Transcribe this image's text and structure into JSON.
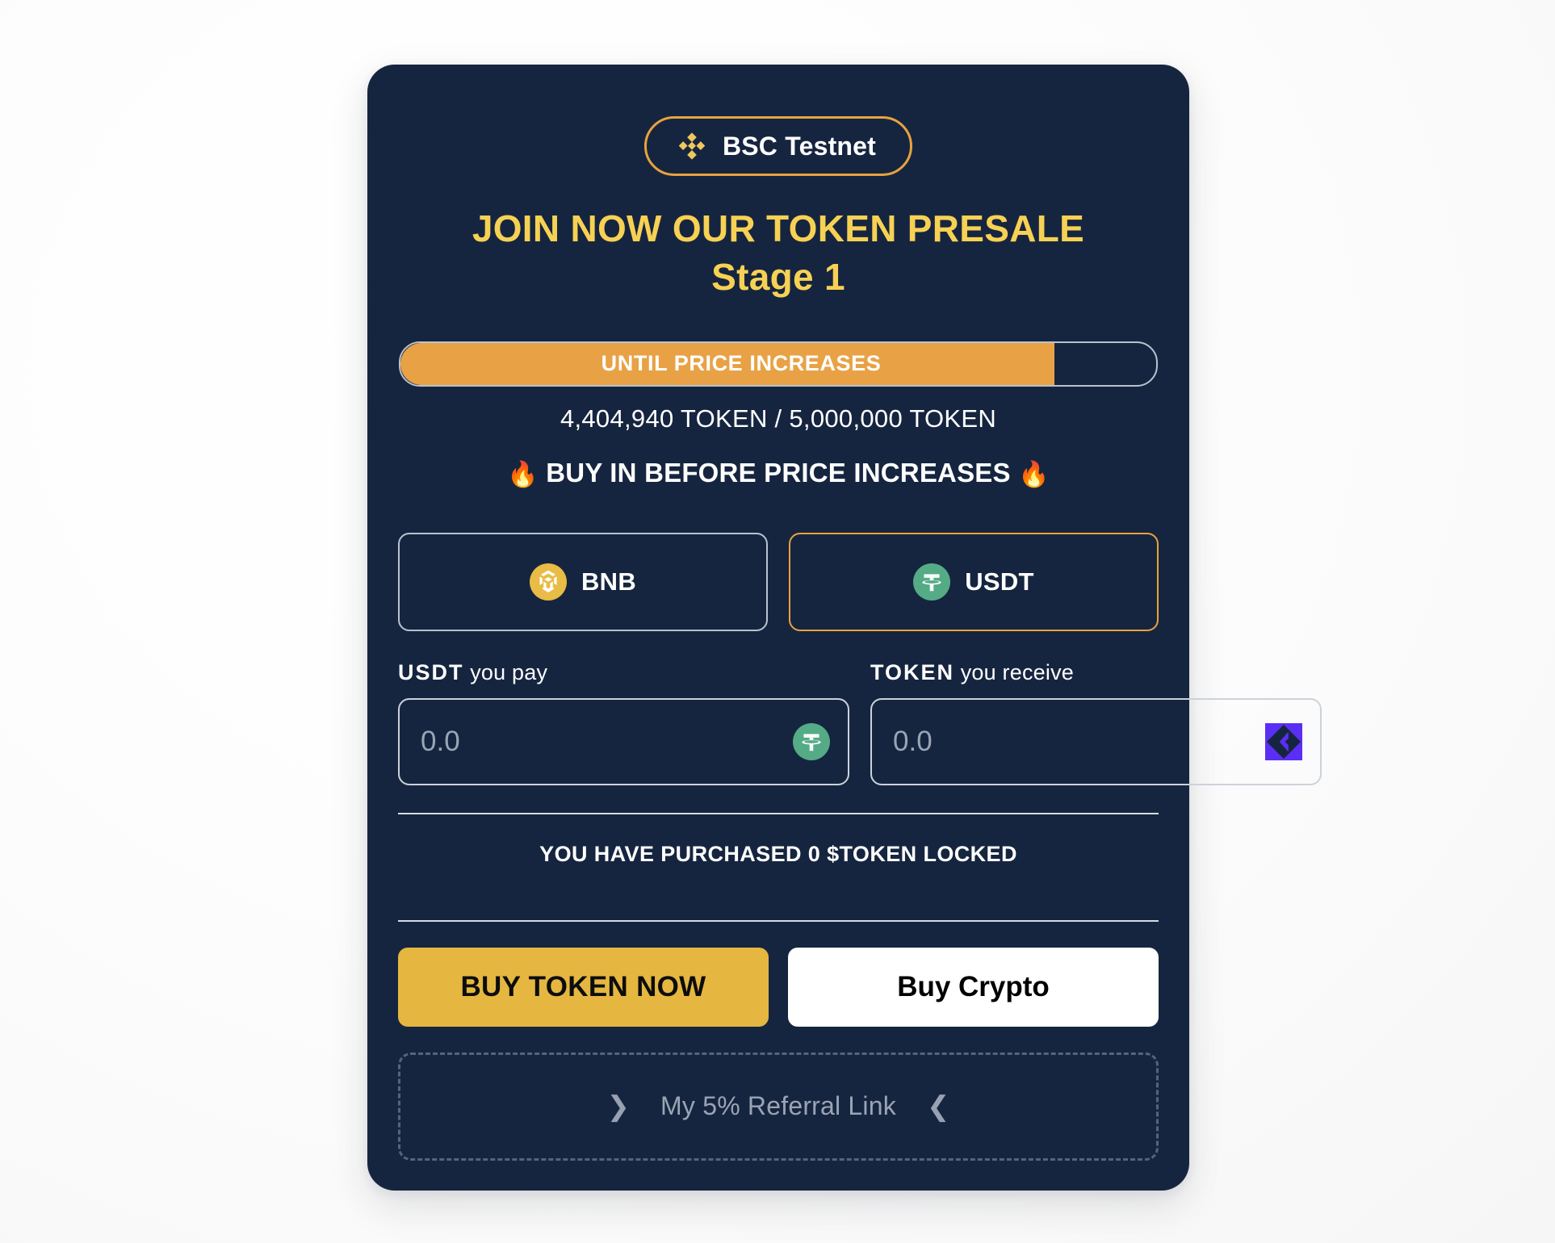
{
  "network": {
    "label": "BSC Testnet",
    "icon": "bnb-diamond-icon",
    "border_color": "#e8a33d"
  },
  "headline": {
    "line1": "JOIN NOW OUR TOKEN PRESALE",
    "line2": "Stage 1",
    "color": "#f7d154"
  },
  "progress": {
    "label": "UNTIL PRICE INCREASES",
    "percent": 86.5,
    "fill_color": "#e8a245",
    "sold": "4,404,940 TOKEN",
    "total": "5,000,000 TOKEN",
    "count_text": "4,404,940 TOKEN / 5,000,000 TOKEN"
  },
  "promo": {
    "flame_left": "🔥",
    "text": "BUY IN BEFORE PRICE INCREASES",
    "flame_right": "🔥"
  },
  "currency_selector": {
    "options": [
      {
        "id": "bnb",
        "label": "BNB",
        "icon": "bnb-coin-icon",
        "selected": false
      },
      {
        "id": "usdt",
        "label": "USDT",
        "icon": "usdt-coin-icon",
        "selected": true
      }
    ]
  },
  "pay_field": {
    "label_strong": "USDT",
    "label_soft": " you pay",
    "value": "",
    "placeholder": "0.0",
    "icon": "usdt-coin-icon"
  },
  "receive_field": {
    "label_strong": "TOKEN",
    "label_soft": " you receive",
    "value": "",
    "placeholder": "0.0",
    "icon": "token-logo-icon"
  },
  "purchased": {
    "text": "YOU HAVE PURCHASED 0 $TOKEN LOCKED"
  },
  "actions": {
    "buy_token": "BUY TOKEN NOW",
    "buy_crypto": "Buy Crypto"
  },
  "referral": {
    "chevron_left": "❯",
    "text": "My 5% Referral Link",
    "chevron_right": "❮"
  }
}
